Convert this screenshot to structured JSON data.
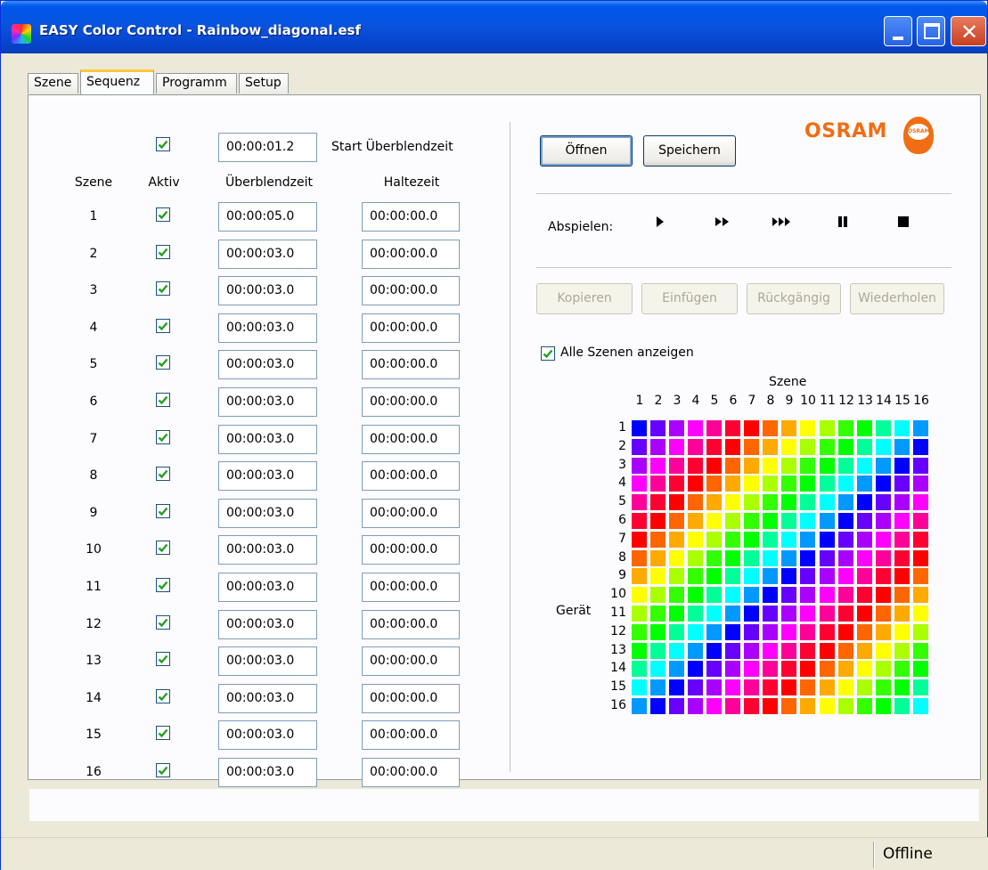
{
  "window": {
    "title": "EASY Color Control - Rainbow_diagonal.esf"
  },
  "tabs": [
    "Szene",
    "Sequenz",
    "Programm",
    "Setup"
  ],
  "sequence": {
    "start_value": "00:00:01.2",
    "start_label": "Start Überblendzeit",
    "headers": {
      "scene": "Szene",
      "active": "Aktiv",
      "fade": "Überblendzeit",
      "hold": "Haltezeit"
    },
    "rows": [
      {
        "scene": "1",
        "fade": "00:00:05.0",
        "hold": "00:00:00.0"
      },
      {
        "scene": "2",
        "fade": "00:00:03.0",
        "hold": "00:00:00.0"
      },
      {
        "scene": "3",
        "fade": "00:00:03.0",
        "hold": "00:00:00.0"
      },
      {
        "scene": "4",
        "fade": "00:00:03.0",
        "hold": "00:00:00.0"
      },
      {
        "scene": "5",
        "fade": "00:00:03.0",
        "hold": "00:00:00.0"
      },
      {
        "scene": "6",
        "fade": "00:00:03.0",
        "hold": "00:00:00.0"
      },
      {
        "scene": "7",
        "fade": "00:00:03.0",
        "hold": "00:00:00.0"
      },
      {
        "scene": "8",
        "fade": "00:00:03.0",
        "hold": "00:00:00.0"
      },
      {
        "scene": "9",
        "fade": "00:00:03.0",
        "hold": "00:00:00.0"
      },
      {
        "scene": "10",
        "fade": "00:00:03.0",
        "hold": "00:00:00.0"
      },
      {
        "scene": "11",
        "fade": "00:00:03.0",
        "hold": "00:00:00.0"
      },
      {
        "scene": "12",
        "fade": "00:00:03.0",
        "hold": "00:00:00.0"
      },
      {
        "scene": "13",
        "fade": "00:00:03.0",
        "hold": "00:00:00.0"
      },
      {
        "scene": "14",
        "fade": "00:00:03.0",
        "hold": "00:00:00.0"
      },
      {
        "scene": "15",
        "fade": "00:00:03.0",
        "hold": "00:00:00.0"
      },
      {
        "scene": "16",
        "fade": "00:00:03.0",
        "hold": "00:00:00.0"
      }
    ]
  },
  "file_buttons": {
    "open": "Öffnen",
    "save": "Speichern"
  },
  "logo": {
    "text": "OSRAM",
    "bulb_text": "OSRAM"
  },
  "playback": {
    "label": "Abspielen:",
    "icons": [
      "play-icon",
      "fast-forward-icon",
      "faster-forward-icon",
      "pause-icon",
      "stop-icon"
    ]
  },
  "edit_buttons": [
    "Kopieren",
    "Einfügen",
    "Rückgängig",
    "Wiederholen"
  ],
  "show_all": {
    "label": "Alle Szenen anzeigen",
    "checked": true
  },
  "matrix": {
    "col_title": "Szene",
    "row_title": "Gerät",
    "col_labels": [
      "1",
      "2",
      "3",
      "4",
      "5",
      "6",
      "7",
      "8",
      "9",
      "10",
      "11",
      "12",
      "13",
      "14",
      "15",
      "16"
    ],
    "row_labels": [
      "1",
      "2",
      "3",
      "4",
      "5",
      "6",
      "7",
      "8",
      "9",
      "10",
      "11",
      "12",
      "13",
      "14",
      "15",
      "16"
    ],
    "palette": [
      "#0000ff",
      "#6600ff",
      "#aa00ff",
      "#ff00ff",
      "#ff0099",
      "#ff0033",
      "#ff0000",
      "#ff6600",
      "#ffaa00",
      "#ffff00",
      "#aaff00",
      "#33ff00",
      "#00ff00",
      "#00ff99",
      "#00ffff",
      "#0099ff"
    ],
    "row_offsets": [
      0,
      1,
      2,
      3,
      4,
      5,
      6,
      7,
      8,
      9,
      10,
      11,
      12,
      13,
      14,
      15
    ]
  },
  "status": {
    "text": "Offline"
  },
  "colors": {
    "accent": "#f06d14",
    "title_bar": "#0a52dc",
    "check": "#21a121"
  }
}
